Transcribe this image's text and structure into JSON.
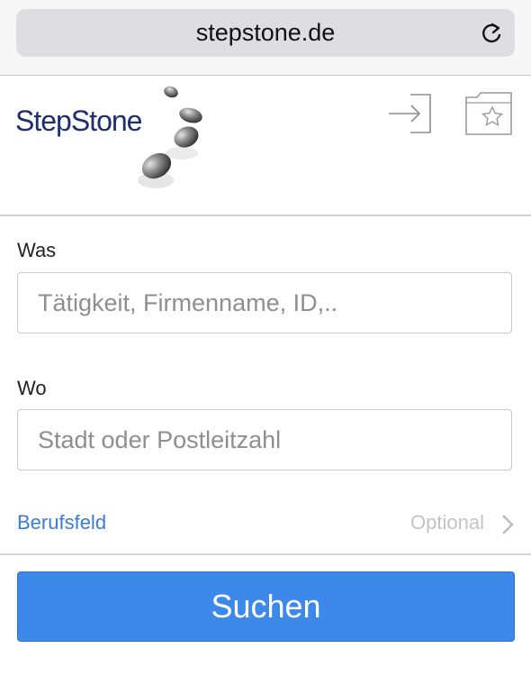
{
  "browser": {
    "url": "stepstone.de",
    "reload_icon": "reload-icon"
  },
  "header": {
    "logo_text": "StepStone",
    "login_icon": "login-icon",
    "saved_icon": "saved-jobs-star-folder-icon"
  },
  "form": {
    "was_label": "Was",
    "was_placeholder": "Tätigkeit, Firmenname, ID,..",
    "was_value": "",
    "wo_label": "Wo",
    "wo_placeholder": "Stadt oder Postleitzahl",
    "wo_value": "",
    "berufsfeld_label": "Berufsfeld",
    "berufsfeld_value": "Optional",
    "search_label": "Suchen"
  },
  "colors": {
    "accent": "#3d89ea",
    "link": "#3a7cd6",
    "logo": "#1f2f6e"
  }
}
